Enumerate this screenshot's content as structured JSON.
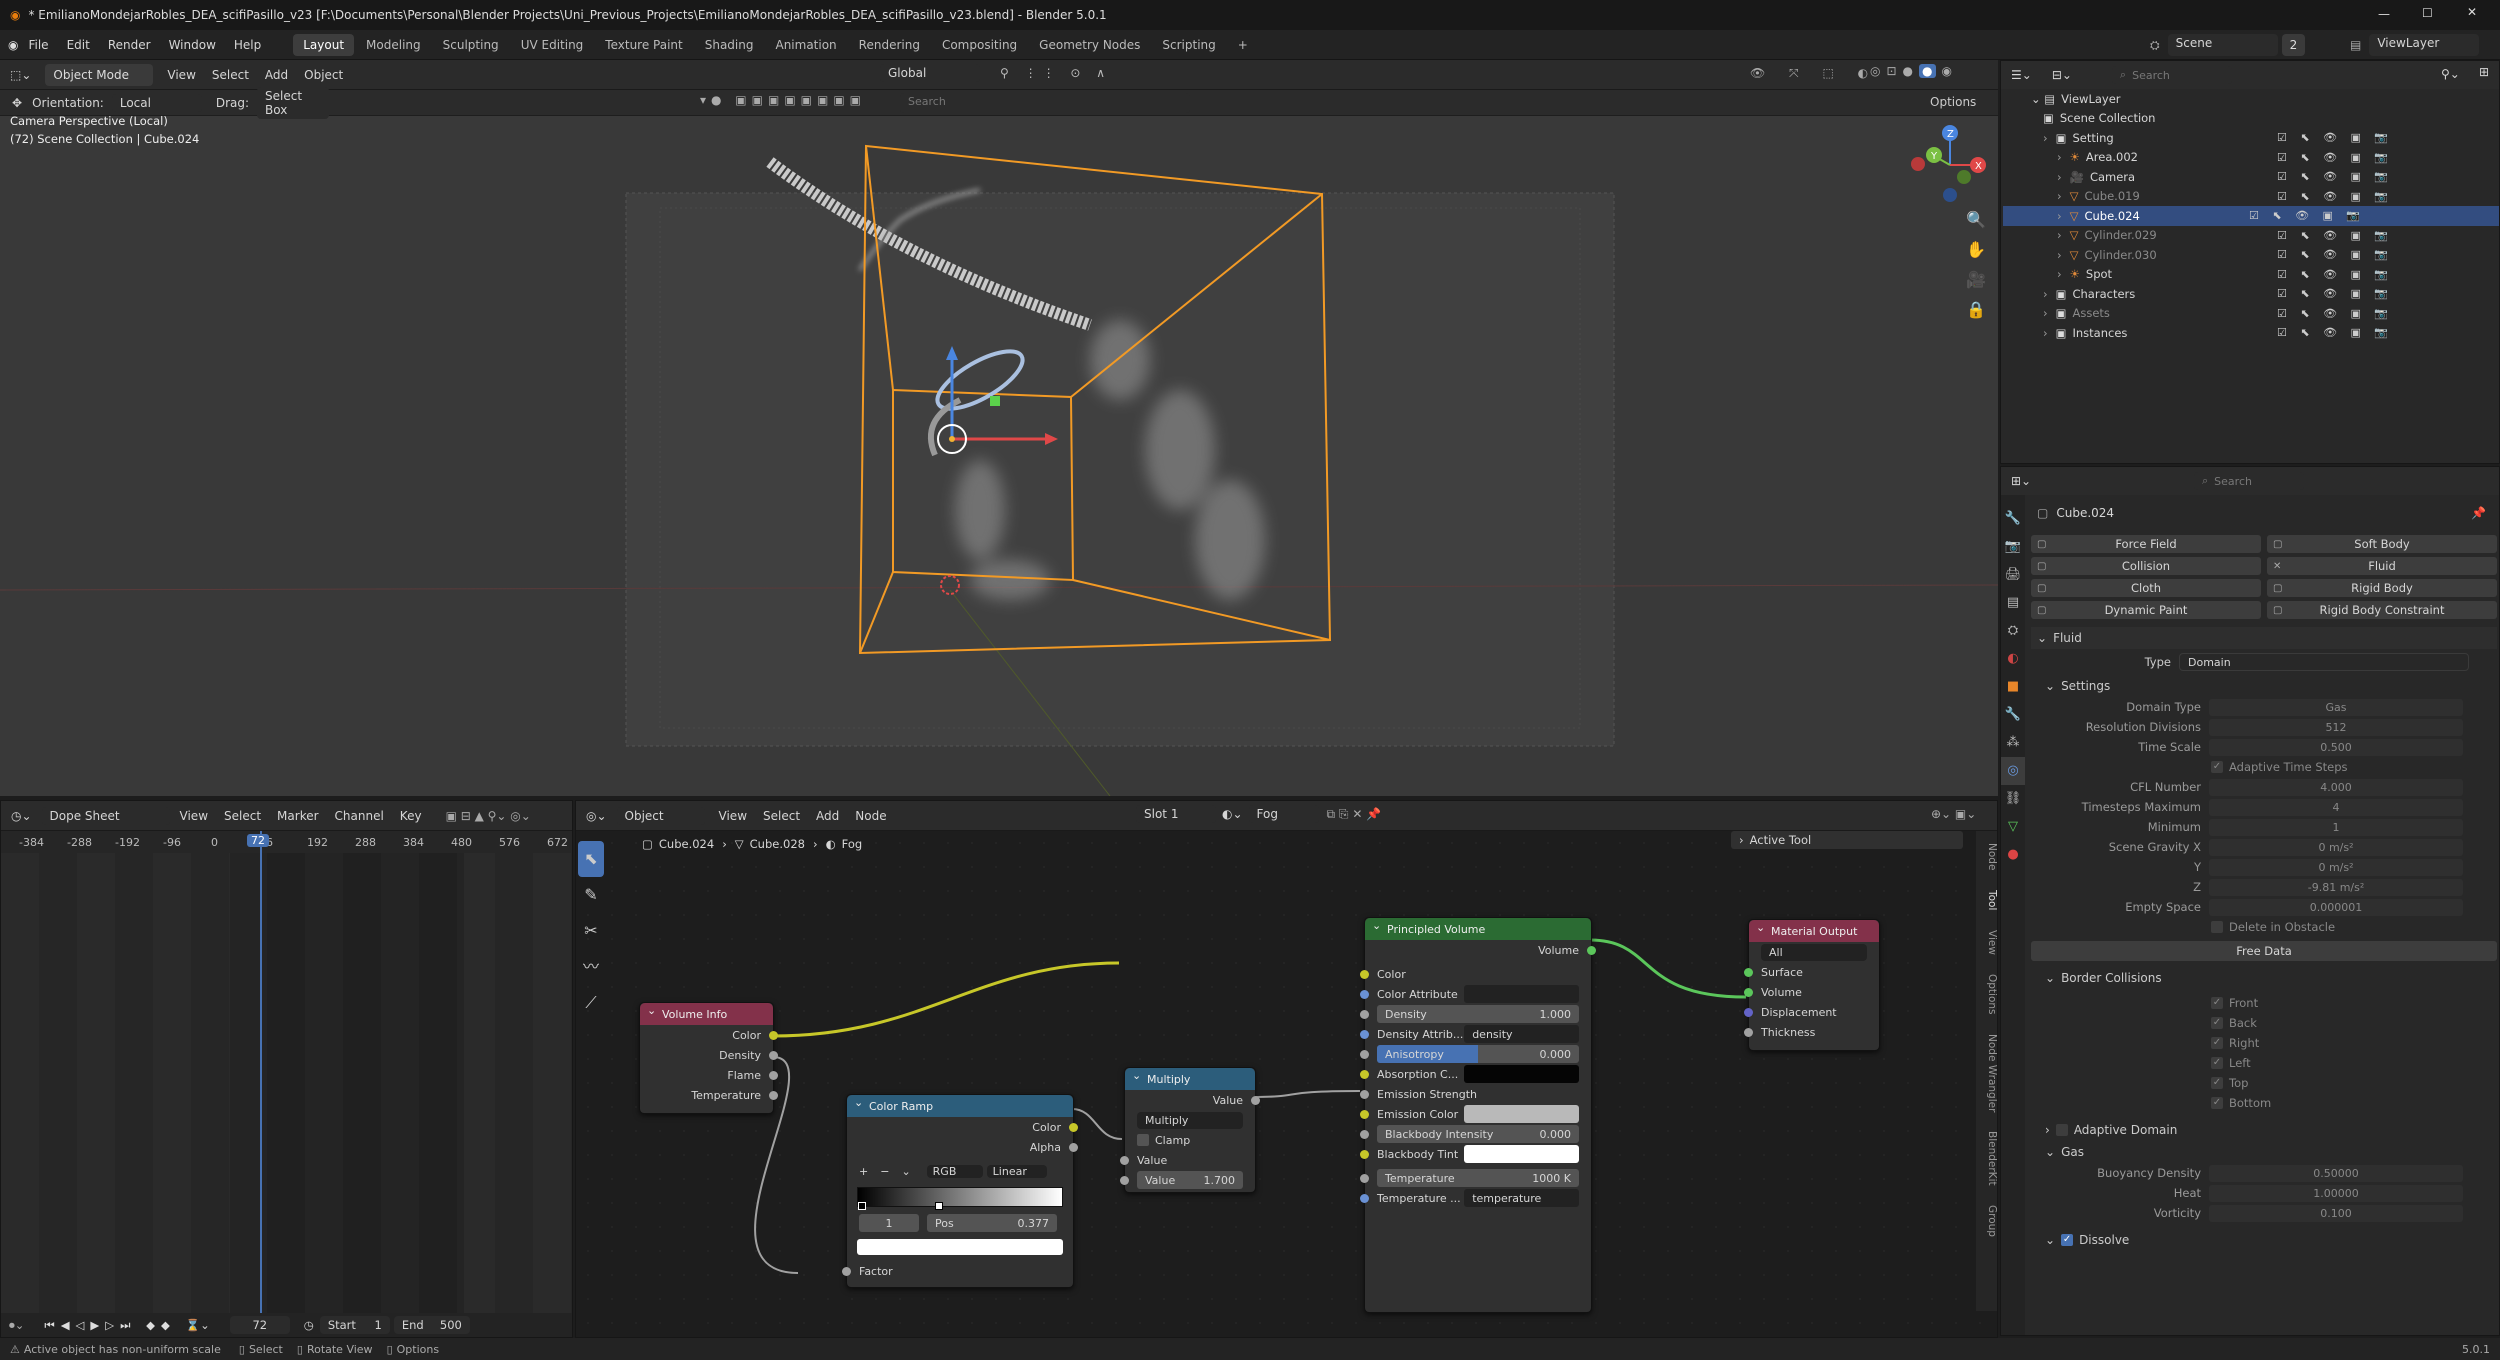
{
  "window": {
    "title": "* EmilianoMondejarRobles_DEA_scifiPasillo_v23 [F:\\Documents\\Personal\\Blender Projects\\Uni_Previous_Projects\\EmilianoMondejarRobles_DEA_scifiPasillo_v23.blend] - Blender 5.0.1"
  },
  "menu": [
    "File",
    "Edit",
    "Render",
    "Window",
    "Help"
  ],
  "workspaces": [
    "Layout",
    "Modeling",
    "Sculpting",
    "UV Editing",
    "Texture Paint",
    "Shading",
    "Animation",
    "Rendering",
    "Compositing",
    "Geometry Nodes",
    "Scripting"
  ],
  "scene": {
    "name": "Scene",
    "count": "2",
    "view_layer": "ViewLayer"
  },
  "viewport": {
    "mode": "Object Mode",
    "menus": [
      "View",
      "Select",
      "Add",
      "Object"
    ],
    "transform": "Global",
    "orientation_label": "Orientation:",
    "orientation": "Local",
    "drag_label": "Drag:",
    "drag": "Select Box",
    "search_placeholder": "Search",
    "options": "Options",
    "overlay1": "Camera Perspective (Local)",
    "overlay2": "(72) Scene Collection | Cube.024"
  },
  "outliner": {
    "search_placeholder": "Search",
    "root": "ViewLayer",
    "scene_collection": "Scene Collection",
    "items": [
      {
        "label": "Setting",
        "level": 1,
        "icon": "collection-icon",
        "dim": false,
        "selected": false
      },
      {
        "label": "Area.002",
        "level": 2,
        "icon": "light-icon",
        "dim": false,
        "selected": false
      },
      {
        "label": "Camera",
        "level": 2,
        "icon": "camera-icon",
        "dim": false,
        "selected": false
      },
      {
        "label": "Cube.019",
        "level": 2,
        "icon": "mesh-icon",
        "dim": true,
        "selected": false
      },
      {
        "label": "Cube.024",
        "level": 2,
        "icon": "mesh-icon",
        "dim": false,
        "selected": true
      },
      {
        "label": "Cylinder.029",
        "level": 2,
        "icon": "mesh-icon",
        "dim": true,
        "selected": false
      },
      {
        "label": "Cylinder.030",
        "level": 2,
        "icon": "mesh-icon",
        "dim": true,
        "selected": false
      },
      {
        "label": "Spot",
        "level": 2,
        "icon": "light-icon",
        "dim": false,
        "selected": false
      },
      {
        "label": "Characters",
        "level": 1,
        "icon": "collection-icon",
        "dim": false,
        "selected": false
      },
      {
        "label": "Assets",
        "level": 1,
        "icon": "collection-icon",
        "dim": true,
        "selected": false
      },
      {
        "label": "Instances",
        "level": 1,
        "icon": "collection-icon",
        "dim": false,
        "selected": false
      }
    ]
  },
  "properties": {
    "search_placeholder": "Search",
    "object": "Cube.024",
    "physics_buttons": [
      [
        "Force Field",
        "Soft Body"
      ],
      [
        "Collision",
        "Fluid"
      ],
      [
        "Cloth",
        "Rigid Body"
      ],
      [
        "Dynamic Paint",
        "Rigid Body Constraint"
      ]
    ],
    "fluid_title": "Fluid",
    "type_label": "Type",
    "type_value": "Domain",
    "settings_title": "Settings",
    "settings": [
      {
        "label": "Domain Type",
        "value": "Gas"
      },
      {
        "label": "Resolution Divisions",
        "value": "512"
      },
      {
        "label": "Time Scale",
        "value": "0.500"
      }
    ],
    "adaptive_time": "Adaptive Time Steps",
    "settings2": [
      {
        "label": "CFL Number",
        "value": "4.000"
      },
      {
        "label": "Timesteps Maximum",
        "value": "4"
      },
      {
        "label": "Minimum",
        "value": "1"
      },
      {
        "label": "Scene Gravity X",
        "value": "0 m/s²"
      },
      {
        "label": "Y",
        "value": "0 m/s²"
      },
      {
        "label": "Z",
        "value": "-9.81 m/s²"
      },
      {
        "label": "Empty Space",
        "value": "0.000001"
      }
    ],
    "delete_obstacle": "Delete in Obstacle",
    "free_data": "Free Data",
    "border_title": "Border Collisions",
    "borders": [
      "Front",
      "Back",
      "Right",
      "Left",
      "Top",
      "Bottom"
    ],
    "adaptive_domain": "Adaptive Domain",
    "gas_title": "Gas",
    "gas": [
      {
        "label": "Buoyancy Density",
        "value": "0.50000"
      },
      {
        "label": "Heat",
        "value": "1.00000"
      },
      {
        "label": "Vorticity",
        "value": "0.100"
      }
    ],
    "dissolve": "Dissolve"
  },
  "dopesheet": {
    "mode": "Dope Sheet",
    "menus": [
      "View",
      "Select",
      "Marker",
      "Channel",
      "Key"
    ],
    "ruler": [
      "-384",
      "-288",
      "-192",
      "-96",
      "0",
      "96",
      "192",
      "288",
      "384",
      "480",
      "576",
      "672"
    ],
    "current_frame": "72",
    "start_label": "Start",
    "start": "1",
    "end_label": "End",
    "end": "500"
  },
  "node_editor": {
    "type": "Object",
    "menus": [
      "View",
      "Select",
      "Add",
      "Node"
    ],
    "slot": "Slot 1",
    "material": "Fog",
    "breadcrumb": [
      "Cube.024",
      "Cube.028",
      "Fog"
    ],
    "active_tool": "Active Tool",
    "side_tabs": [
      "Node",
      "Tool",
      "View",
      "Options",
      "Node Wrangler",
      "BlenderKit",
      "Group"
    ],
    "volume_info": {
      "title": "Volume Info",
      "outputs": [
        "Color",
        "Density",
        "Flame",
        "Temperature"
      ]
    },
    "color_ramp": {
      "title": "Color Ramp",
      "outputs": [
        "Color",
        "Alpha"
      ],
      "mode": "RGB",
      "interp": "Linear",
      "index": "1",
      "pos_label": "Pos",
      "pos": "0.377",
      "input": "Factor"
    },
    "multiply": {
      "title": "Multiply",
      "output": "Value",
      "op": "Multiply",
      "clamp": "Clamp",
      "in1": "Value",
      "in2_label": "Value",
      "in2": "1.700"
    },
    "principled": {
      "title": "Principled Volume",
      "output": "Volume",
      "color": "Color",
      "color_attr": "Color Attribute",
      "density_label": "Density",
      "density": "1.000",
      "density_attr_label": "Density Attrib...",
      "density_attr": "density",
      "anisotropy_label": "Anisotropy",
      "anisotropy": "0.000",
      "absorption": "Absorption C...",
      "emission_strength": "Emission Strength",
      "emission_color": "Emission Color",
      "bb_intensity_label": "Blackbody Intensity",
      "bb_intensity": "0.000",
      "bb_tint": "Blackbody Tint",
      "temp_label": "Temperature",
      "temp": "1000 K",
      "temp_attr_label": "Temperature ...",
      "temp_attr": "temperature"
    },
    "material_output": {
      "title": "Material Output",
      "target": "All",
      "inputs": [
        "Surface",
        "Volume",
        "Displacement",
        "Thickness"
      ]
    }
  },
  "status": {
    "message": "Active object has non-uniform scale",
    "select": "Select",
    "rotate": "Rotate View",
    "options": "Options",
    "version": "5.0.1"
  }
}
